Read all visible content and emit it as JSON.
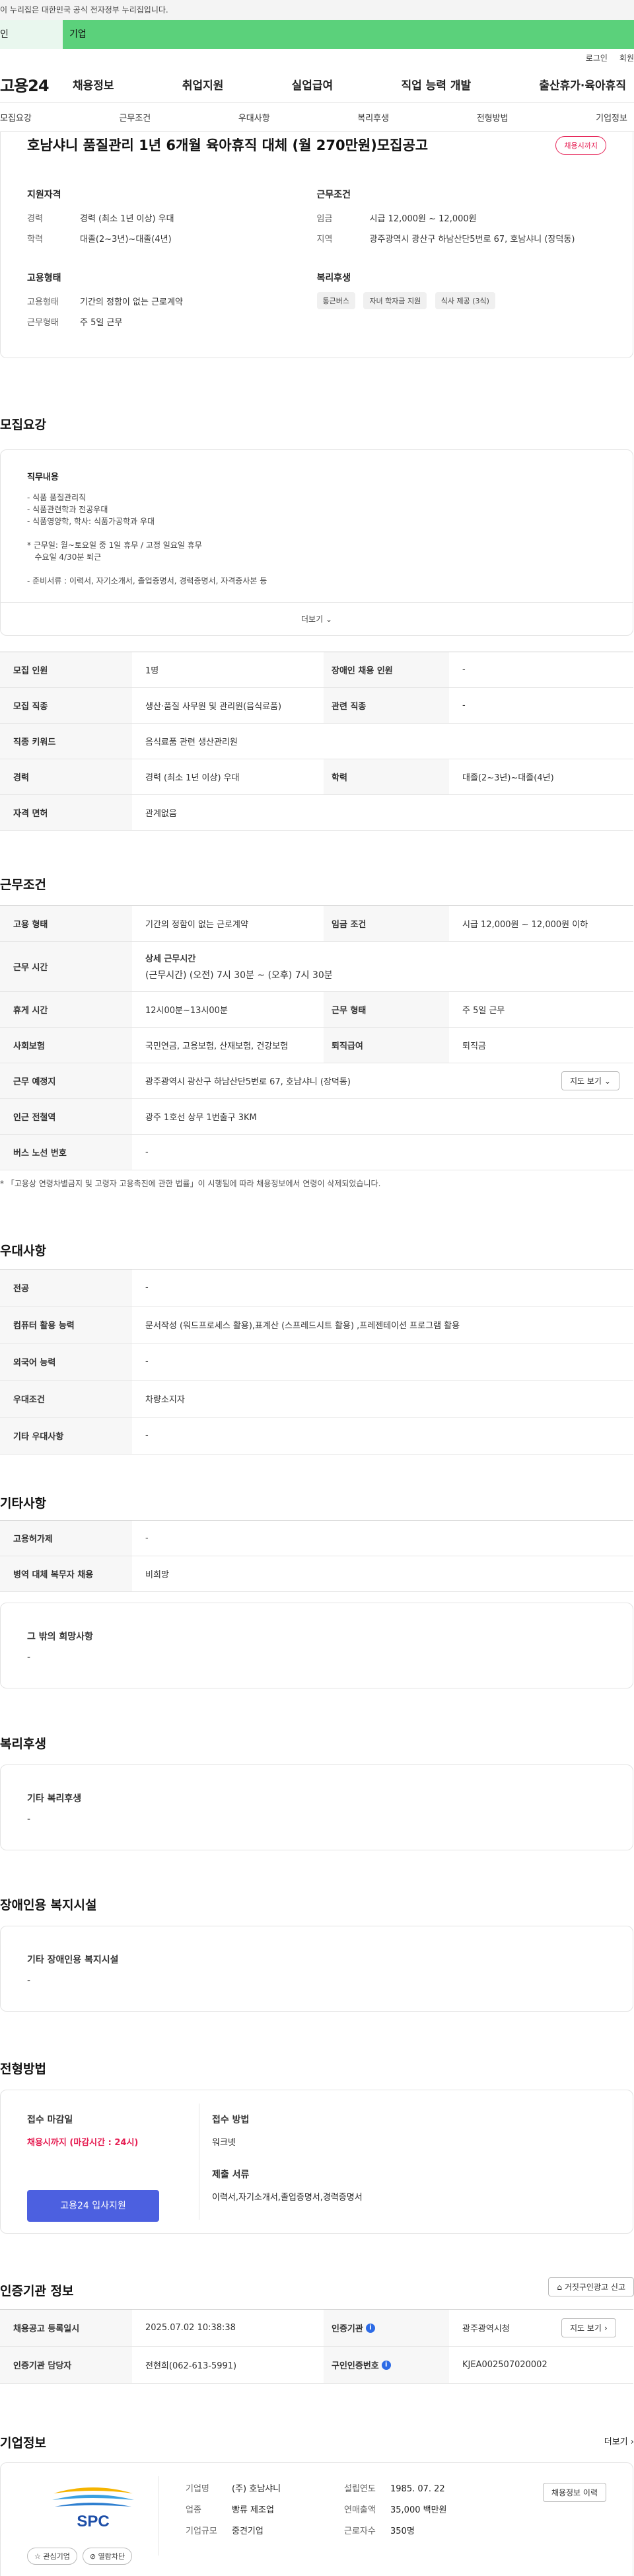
{
  "gov": {
    "text": "이 누리집은 대한민국 공식 전자정부 누리집입니다."
  },
  "cats": {
    "person": "인",
    "company": "기업"
  },
  "util": {
    "login": "로그인",
    "join": "회원"
  },
  "logo": "고용24",
  "gnb": [
    "채용정보",
    "취업지원",
    "실업급여",
    "직업 능력 개발",
    "출산휴가·육아휴직"
  ],
  "tabs": [
    "모집요강",
    "근무조건",
    "우대사항",
    "복리후생",
    "전형방법",
    "기업정보"
  ],
  "hero": {
    "title": "호남샤니 품질관리 1년 6개월 육아휴직 대체 (월 270만원)모집공고",
    "badge": "채용시까지",
    "qual": {
      "title": "지원자격",
      "career_k": "경력",
      "career_v": "경력 (최소 1년 이상) 우대",
      "edu_k": "학력",
      "edu_v": "대졸(2~3년)~대졸(4년)"
    },
    "cond": {
      "title": "근무조건",
      "wage_k": "임금",
      "wage_v": "시급 12,000원 ~ 12,000원",
      "area_k": "지역",
      "area_v": "광주광역시 광산구 하남산단5번로 67, 호남샤니 (장덕동)"
    },
    "emp": {
      "title": "고용형태",
      "type_k": "고용형태",
      "type_v": "기간의 정함이 없는 근로계약",
      "work_k": "근무형태",
      "work_v": "주 5일 근무"
    },
    "welfare": {
      "title": "복리후생",
      "chips": [
        "통근버스",
        "자녀 학자금 지원",
        "식사 제공 (3식)"
      ]
    }
  },
  "recruit": {
    "title": "모집요강",
    "duty_title": "직무내용",
    "duty_lines": [
      "- 식품 품질관리직",
      "- 식품관련학과 전공우대",
      "- 식품영양학, 학사: 식품가공학과 우대",
      "",
      "* 근무일: 월~토요일 중 1일 휴무 / 고정 일요일 휴무",
      "   수요일 4/30분 퇴근",
      "",
      "- 준비서류 : 이력서, 자기소개서, 졸업증명서, 경력증명서, 자격증사본 등"
    ],
    "more": "더보기",
    "rows": [
      {
        "k1": "모집 인원",
        "v1": "1명",
        "k2": "장애인 채용 인원",
        "v2": "-"
      },
      {
        "k1": "모집 직종",
        "v1": "생산·품질 사무원 및 관리원(음식료품)",
        "k2": "관련 직종",
        "v2": "-"
      },
      {
        "k1": "직종 키워드",
        "v1": "음식료품 관련 생산관리원"
      },
      {
        "k1": "경력",
        "v1": "경력 (최소 1년 이상) 우대",
        "k2": "학력",
        "v2": "대졸(2~3년)~대졸(4년)"
      },
      {
        "k1": "자격 면허",
        "v1": "관계없음"
      }
    ]
  },
  "work": {
    "title": "근무조건",
    "emp_k": "고용 형태",
    "emp_v": "기간의 정함이 없는 근로계약",
    "wage_k": "임금 조건",
    "wage_v": "시급 12,000원 ~ 12,000원 이하",
    "time_k": "근무 시간",
    "time_title": "상세 근무시간",
    "time_v": "(근무시간) (오전) 7시 30분 ~ (오후) 7시 30분",
    "rest_k": "휴게 시간",
    "rest_v": "12시00분~13시00분",
    "form_k": "근무 형태",
    "form_v": "주 5일 근무",
    "ins_k": "사회보험",
    "ins_v": "국민연금, 고용보험, 산재보험, 건강보험",
    "ret_k": "퇴직급여",
    "ret_v": "퇴직금",
    "place_k": "근무 예정지",
    "place_v": "광주광역시 광산구 하남산단5번로 67, 호남샤니 (장덕동)",
    "map_btn": "지도 보기",
    "sub_k": "인근 전철역",
    "sub_v": "광주 1호선 상무 1번출구 3KM",
    "bus_k": "버스 노선 번호",
    "bus_v": "-",
    "note": "* 「고용상 연령차별금지 및 고령자 고용촉진에 관한 법률」이 시행됨에 따라 채용정보에서 연령이 삭제되었습니다."
  },
  "pref": {
    "title": "우대사항",
    "rows": [
      {
        "k": "전공",
        "v": "-"
      },
      {
        "k": "컴퓨터 활용 능력",
        "v": "문서작성 (워드프로세스 활용),표계산 (스프레드시트 활용) ,프레젠테이션 프로그램 활용"
      },
      {
        "k": "외국어 능력",
        "v": "-"
      },
      {
        "k": "우대조건",
        "v": "차량소지자"
      },
      {
        "k": "기타 우대사항",
        "v": "-"
      }
    ]
  },
  "etc": {
    "title": "기타사항",
    "rows": [
      {
        "k": "고용허가제",
        "v": "-"
      },
      {
        "k": "병역 대체 복무자 채용",
        "v": "비희망"
      }
    ],
    "other_title": "그 밖의 희망사항",
    "other_v": "-"
  },
  "benefit": {
    "title": "복리후생",
    "sub": "기타 복리후생",
    "v": "-"
  },
  "disabled": {
    "title": "장애인용 복지시설",
    "sub": "기타 장애인용 복지시설",
    "v": "-"
  },
  "process": {
    "title": "전형방법",
    "deadline_k": "접수 마감일",
    "deadline_v": "채용시까지 (마감시간 : 24시)",
    "apply_btn": "고용24 입사지원",
    "method_k": "접수 방법",
    "method_v": "워크넷",
    "docs_k": "제출 서류",
    "docs_v": "이력서,자기소개서,졸업증명서,경력증명서"
  },
  "agency": {
    "title": "인증기관 정보",
    "report_btn": "거짓구인광고 신고",
    "reg_k": "채용공고 등록일시",
    "reg_v": "2025.07.02 10:38:38",
    "org_k": "인증기관",
    "org_v": "광주광역시청",
    "map_btn": "지도 보기",
    "staff_k": "인증기관 담당자",
    "staff_v": "전현희(062-613-5991)",
    "no_k": "구인인증번호",
    "no_v": "KJEA002507020002"
  },
  "company": {
    "title": "기업정보",
    "more": "더보기",
    "logo_text": "SPC",
    "fav_btn": "관심기업",
    "block_btn": "열람차단",
    "name_k": "기업명",
    "name_v": "(주) 호남샤니",
    "year_k": "설립연도",
    "year_v": "1985. 07. 22",
    "jobs_btn": "채용정보 이력",
    "ind_k": "업종",
    "ind_v": "빵류 제조업",
    "rev_k": "연매출액",
    "rev_v": "35,000 백만원",
    "size_k": "기업규모",
    "size_v": "중견기업",
    "emp_k": "근로자수",
    "emp_v": "350명"
  },
  "colors": {
    "accent": "#4c60e0",
    "brand_green": "#5bd17b",
    "alert": "#e62155"
  }
}
